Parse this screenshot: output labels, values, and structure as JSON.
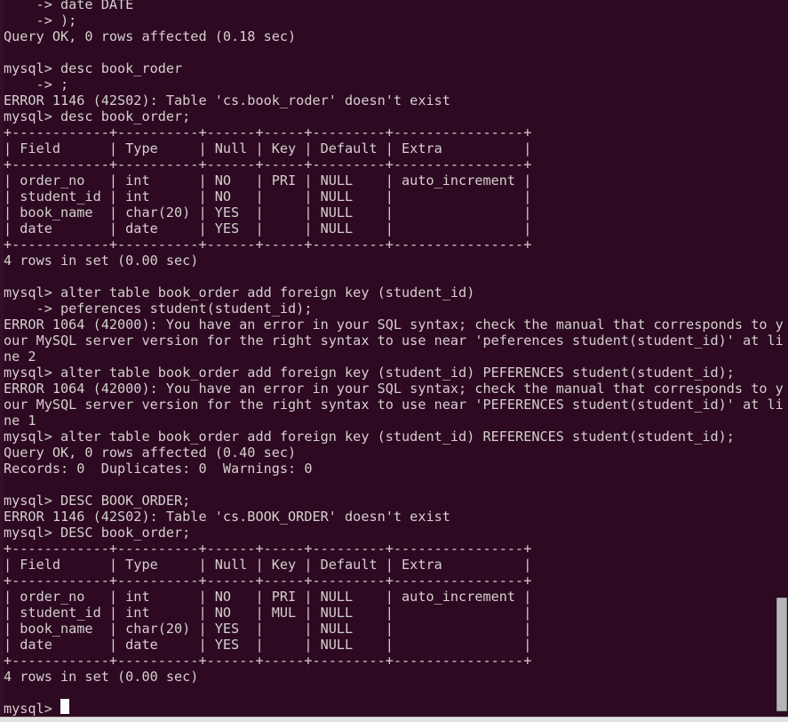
{
  "terminal": {
    "app": "mysql-client-terminal",
    "background_color": "#2d0922",
    "foreground_color": "#d6d0cc",
    "cursor_color": "#ffffff",
    "prompt": "mysql> ",
    "continuation_prompt": "    -> ",
    "columns": 87,
    "lines": [
      "    -> date DATE",
      "    -> );",
      "Query OK, 0 rows affected (0.18 sec)",
      "",
      "mysql> desc book_roder",
      "    -> ;",
      "ERROR 1146 (42S02): Table 'cs.book_roder' doesn't exist",
      "mysql> desc book_order;",
      "+------------+----------+------+-----+---------+----------------+",
      "| Field      | Type     | Null | Key | Default | Extra          |",
      "+------------+----------+------+-----+---------+----------------+",
      "| order_no   | int      | NO   | PRI | NULL    | auto_increment |",
      "| student_id | int      | NO   |     | NULL    |                |",
      "| book_name  | char(20) | YES  |     | NULL    |                |",
      "| date       | date     | YES  |     | NULL    |                |",
      "+------------+----------+------+-----+---------+----------------+",
      "4 rows in set (0.00 sec)",
      "",
      "mysql> alter table book_order add foreign key (student_id)",
      "    -> peferences student(student_id);",
      "ERROR 1064 (42000): You have an error in your SQL syntax; check the manual that corresponds to y",
      "our MySQL server version for the right syntax to use near 'peferences student(student_id)' at li",
      "ne 2",
      "mysql> alter table book_order add foreign key (student_id) PEFERENCES student(student_id);",
      "ERROR 1064 (42000): You have an error in your SQL syntax; check the manual that corresponds to y",
      "our MySQL server version for the right syntax to use near 'PEFERENCES student(student_id)' at li",
      "ne 1",
      "mysql> alter table book_order add foreign key (student_id) REFERENCES student(student_id);",
      "Query OK, 0 rows affected (0.40 sec)",
      "Records: 0  Duplicates: 0  Warnings: 0",
      "",
      "mysql> DESC BOOK_ORDER;",
      "ERROR 1146 (42S02): Table 'cs.BOOK_ORDER' doesn't exist",
      "mysql> DESC book_order;",
      "+------------+----------+------+-----+---------+----------------+",
      "| Field      | Type     | Null | Key | Default | Extra          |",
      "+------------+----------+------+-----+---------+----------------+",
      "| order_no   | int      | NO   | PRI | NULL    | auto_increment |",
      "| student_id | int      | NO   | MUL | NULL    |                |",
      "| book_name  | char(20) | YES  |     | NULL    |                |",
      "| date       | date     | YES  |     | NULL    |                |",
      "+------------+----------+------+-----+---------+----------------+",
      "4 rows in set (0.00 sec)",
      "",
      "mysql> "
    ]
  },
  "tables": {
    "book_order_before_fk": {
      "columns": [
        "Field",
        "Type",
        "Null",
        "Key",
        "Default",
        "Extra"
      ],
      "rows": [
        [
          "order_no",
          "int",
          "NO",
          "PRI",
          "NULL",
          "auto_increment"
        ],
        [
          "student_id",
          "int",
          "NO",
          "",
          "NULL",
          ""
        ],
        [
          "book_name",
          "char(20)",
          "YES",
          "",
          "NULL",
          ""
        ],
        [
          "date",
          "date",
          "YES",
          "",
          "NULL",
          ""
        ]
      ],
      "footer": "4 rows in set (0.00 sec)"
    },
    "book_order_after_fk": {
      "columns": [
        "Field",
        "Type",
        "Null",
        "Key",
        "Default",
        "Extra"
      ],
      "rows": [
        [
          "order_no",
          "int",
          "NO",
          "PRI",
          "NULL",
          "auto_increment"
        ],
        [
          "student_id",
          "int",
          "NO",
          "MUL",
          "NULL",
          ""
        ],
        [
          "book_name",
          "char(20)",
          "YES",
          "",
          "NULL",
          ""
        ],
        [
          "date",
          "date",
          "YES",
          "",
          "NULL",
          ""
        ]
      ],
      "footer": "4 rows in set (0.00 sec)"
    }
  },
  "scrollbar": {
    "thumb_color": "#b6b6b6",
    "position": "bottom"
  },
  "taskbar": {
    "background_color": "#e2e2e2"
  }
}
